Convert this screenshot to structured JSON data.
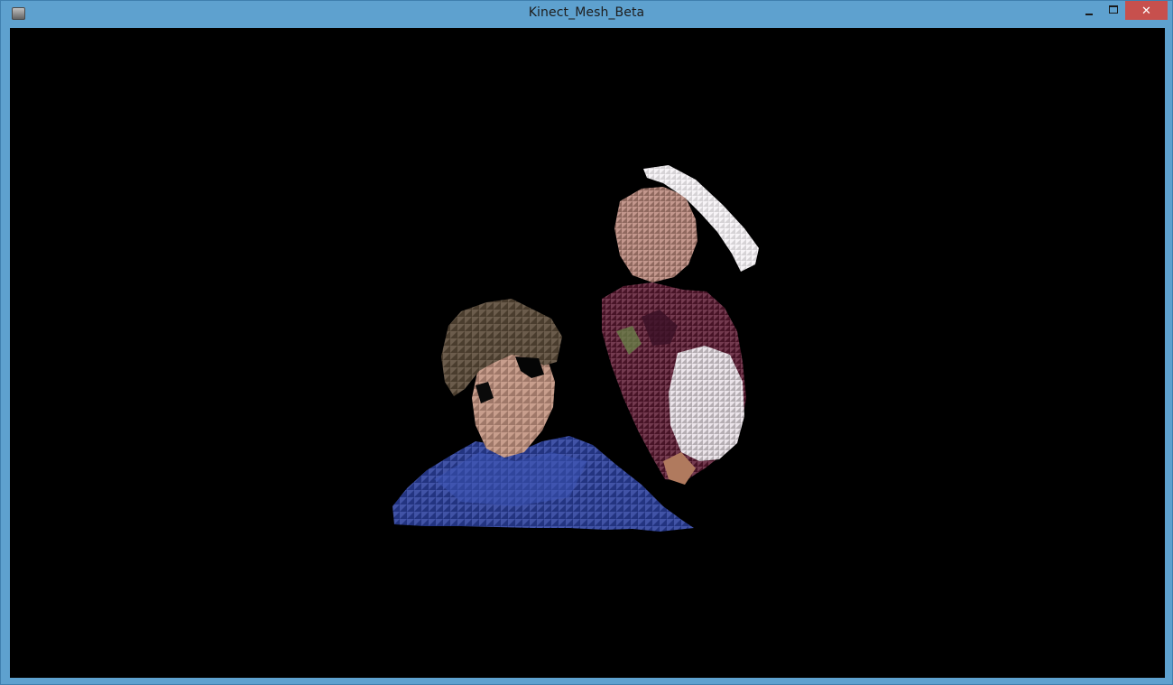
{
  "window": {
    "title": "Kinect_Mesh_Beta",
    "icon": "app-icon",
    "controls": {
      "minimize": "minimize-icon",
      "maximize": "maximize-icon",
      "close": "close-icon",
      "close_glyph": "✕"
    }
  },
  "viewport": {
    "background": "#000000",
    "content": "3d-point-cloud-mesh"
  },
  "colors": {
    "frame": "#5ea1cf",
    "close_button": "#c7504d",
    "shirt_blue": "#2b3f9c",
    "hair_brown": "#5a4a38",
    "skin": "#c0907a",
    "maroon": "#5c1a32",
    "white": "#f2eef2"
  }
}
